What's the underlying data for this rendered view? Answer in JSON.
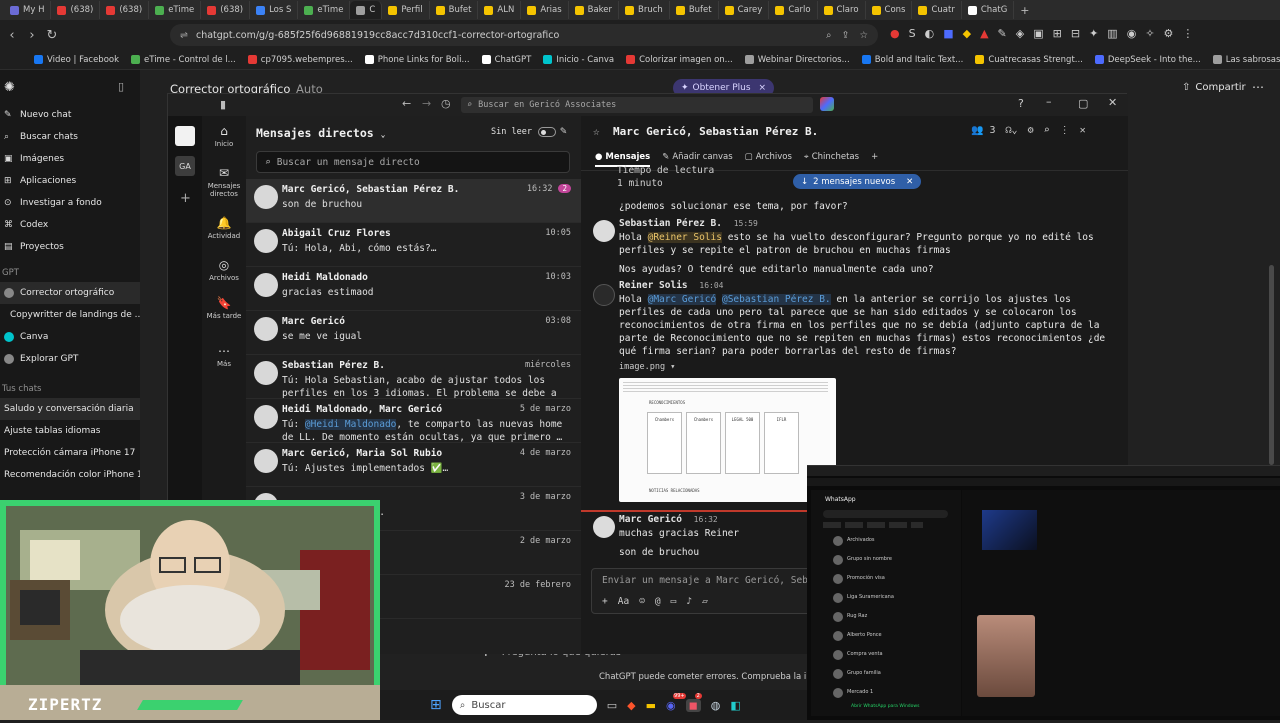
{
  "browser": {
    "tabs": [
      {
        "label": "My H",
        "color": "#6b6bd6"
      },
      {
        "label": "(638)",
        "color": "#e53935"
      },
      {
        "label": "(638)",
        "color": "#e53935"
      },
      {
        "label": "eTime",
        "color": "#4caf50"
      },
      {
        "label": "(638)",
        "color": "#e53935"
      },
      {
        "label": "Los S",
        "color": "#3b82f6"
      },
      {
        "label": "eTime",
        "color": "#4caf50"
      },
      {
        "label": "C",
        "color": "#9e9e9e"
      },
      {
        "label": "Perfil",
        "color": "#f5c400"
      },
      {
        "label": "Bufet",
        "color": "#f5c400"
      },
      {
        "label": "ALN",
        "color": "#f5c400"
      },
      {
        "label": "Arias",
        "color": "#f5c400"
      },
      {
        "label": "Baker",
        "color": "#f5c400"
      },
      {
        "label": "Bruch",
        "color": "#f5c400"
      },
      {
        "label": "Bufet",
        "color": "#f5c400"
      },
      {
        "label": "Carey",
        "color": "#f5c400"
      },
      {
        "label": "Carlo",
        "color": "#f5c400"
      },
      {
        "label": "Claro",
        "color": "#f5c400"
      },
      {
        "label": "Cons",
        "color": "#f5c400"
      },
      {
        "label": "Cuatr",
        "color": "#f5c400"
      },
      {
        "label": "ChatG",
        "color": "#ffffff"
      }
    ],
    "url": "chatgpt.com/g/g-685f25f6d96881919cc8acc7d310ccf1-corrector-ortografico",
    "bookmarks": [
      {
        "label": "Video | Facebook",
        "color": "#1877f2"
      },
      {
        "label": "eTime - Control de l...",
        "color": "#4caf50"
      },
      {
        "label": "cp7095.webempres...",
        "color": "#e53935"
      },
      {
        "label": "Phone Links for Boli...",
        "color": "#ffffff"
      },
      {
        "label": "ChatGPT",
        "color": "#ffffff"
      },
      {
        "label": "Inicio - Canva",
        "color": "#00c4cc"
      },
      {
        "label": "Colorizar imagen on...",
        "color": "#e53935"
      },
      {
        "label": "Webinar Directorios...",
        "color": "#9e9e9e"
      },
      {
        "label": "Bold and Italic Text...",
        "color": "#1877f2"
      },
      {
        "label": "Cuatrecasas Strengt...",
        "color": "#f5c400"
      },
      {
        "label": "DeepSeek - Into the...",
        "color": "#4d6bfe"
      },
      {
        "label": "Las sabrosas recetas...",
        "color": "#9e9e9e"
      }
    ]
  },
  "chatgpt": {
    "sidebar_items": [
      "Nuevo chat",
      "Buscar chats",
      "Imágenes",
      "Aplicaciones",
      "Investigar a fondo",
      "Codex",
      "Proyectos"
    ],
    "gpt_section": "GPT",
    "gpts": [
      "Corrector ortográfico",
      "Copywritter de landings de ...",
      "Canva",
      "Explorar GPT"
    ],
    "chats_section": "Tus chats",
    "chats": [
      "Saludo y conversación diaria",
      "Ajuste tablas idiomas",
      "Protección cámara iPhone 17",
      "Recomendación color iPhone 17"
    ],
    "model_title": "Corrector ortográfico",
    "model_mode": "Auto",
    "plus_button": "Obtener Plus",
    "share": "Compartir",
    "input_placeholder": "Pregunta lo que quieras",
    "disclaimer": "ChatGPT puede cometer errores. Comprueba la información imp"
  },
  "teams": {
    "search_placeholder": "Buscar en Gericó Associates",
    "rail_tenants": [
      "GA"
    ],
    "rail": [
      {
        "label": "Inicio",
        "icon": "⌂"
      },
      {
        "label": "Mensajes directos",
        "icon": "✉"
      },
      {
        "label": "Actividad",
        "icon": "🔔"
      },
      {
        "label": "Archivos",
        "icon": "◎"
      },
      {
        "label": "Más tarde",
        "icon": "🔖"
      },
      {
        "label": "Más",
        "icon": "⋯"
      }
    ],
    "dm_header": "Mensajes directos",
    "unread_label": "Sin leer",
    "dm_search": "Buscar un mensaje directo",
    "dms": [
      {
        "name": "Marc Gericó, Sebastian Pérez B.",
        "time": "16:32",
        "badge": "2",
        "preview": "son de bruchou"
      },
      {
        "name": "Abigail Cruz Flores",
        "time": "10:05",
        "preview": "Tú: Hola, Abi, cómo estás?…"
      },
      {
        "name": "Heidi Maldonado",
        "time": "10:03",
        "preview": "gracias estimaod"
      },
      {
        "name": "Marc Gericó",
        "time": "03:08",
        "preview": "se me ve igual"
      },
      {
        "name": "Sebastian Pérez B.",
        "time": "miércoles",
        "preview": "Tú: Hola Sebastian, acabo de ajustar todos los perfiles en los 3 idiomas. El problema se debe a …"
      },
      {
        "name": "Heidi Maldonado, Marc Gericó",
        "time": "5 de marzo",
        "preview_prefix": "Tú: ",
        "preview_mention": "@Heidi Maldonado",
        "preview": ", te comparto las nuevas home de LL. De momento están ocultas, ya que primero …"
      },
      {
        "name": "Marc Gericó, Maria Sol Rubio",
        "time": "4 de marzo",
        "preview": "Tú: Ajustes implementados ✅…"
      },
      {
        "name": "",
        "time": "3 de marzo",
        "preview": ", no hay problema."
      },
      {
        "name": "Gericó",
        "time": "2 de marzo",
        "preview": "me con él"
      },
      {
        "name": "",
        "time": "23 de febrero",
        "preview": "ner Solis:…"
      }
    ],
    "chat": {
      "title": "Marc Gericó, Sebastian Pérez B.",
      "member_count": "3",
      "tabs": [
        "Mensajes",
        "Añadir canvas",
        "Archivos",
        "Chinchetas"
      ],
      "new_messages": "2 mensajes nuevos",
      "partial_top": [
        "Tiempo de lectura",
        "1 minuto"
      ],
      "q_line": "¿podemos solucionar ese tema, por favor?",
      "msg1": {
        "author": "Sebastian Pérez B.",
        "time": "15:59",
        "pre": "Hola ",
        "mention": "@Reiner Solis",
        "text": " esto se ha vuelto desconfigurar? Pregunto porque yo no edité los perfiles y se repite el patron de bruchou en muchas firmas",
        "text2": "Nos ayudas? O tendré que editarlo manualmente cada uno?"
      },
      "msg2": {
        "author": "Reiner Solis",
        "time": "16:04",
        "pre": "Hola ",
        "mention1": "@Marc Gericó",
        "mention2": "@Sebastian Pérez B.",
        "text": " en la anterior  se corrijo los ajustes los perfiles de cada uno pero tal parece que se han sido editados y se colocaron los reconocimientos de otra firma en los perfiles que no se debía (adjunto captura de la parte de Reconocimiento que no se repiten en muchas firmas) estos reconocimientos ¿de qué firma serian? para poder borrarlas del resto de firmas?",
        "attachment": "image.png",
        "image_caption": "RECONOCIMIENTOS",
        "image_footer": "NOTICIAS RELACIONADAS",
        "image_cards": [
          "Chambers",
          "Chambers",
          "LEGAL 500",
          "IFLR"
        ]
      },
      "msg3": {
        "author": "Marc Gericó",
        "time": "16:32",
        "lines": [
          "muchas gracias Reiner",
          "son de bruchou"
        ]
      },
      "composer_placeholder": "Enviar un mensaje a Marc Gericó, Sebas"
    }
  },
  "overlay": {
    "streamer": "ZIPERTZ"
  },
  "taskbar": {
    "search": "Buscar",
    "badges": [
      "99+",
      "2"
    ]
  },
  "whatsapp": {
    "title": "WhatsApp",
    "chats": [
      "Archivados",
      "Grupo sin nombre",
      "Promoción visa",
      "Liga Suramericana",
      "Rug Raz",
      "Alberto Ponce",
      "Compra venta",
      "Grupo familia",
      "Mercado 1"
    ],
    "footer": "Abrir WhatsApp para Windows"
  }
}
